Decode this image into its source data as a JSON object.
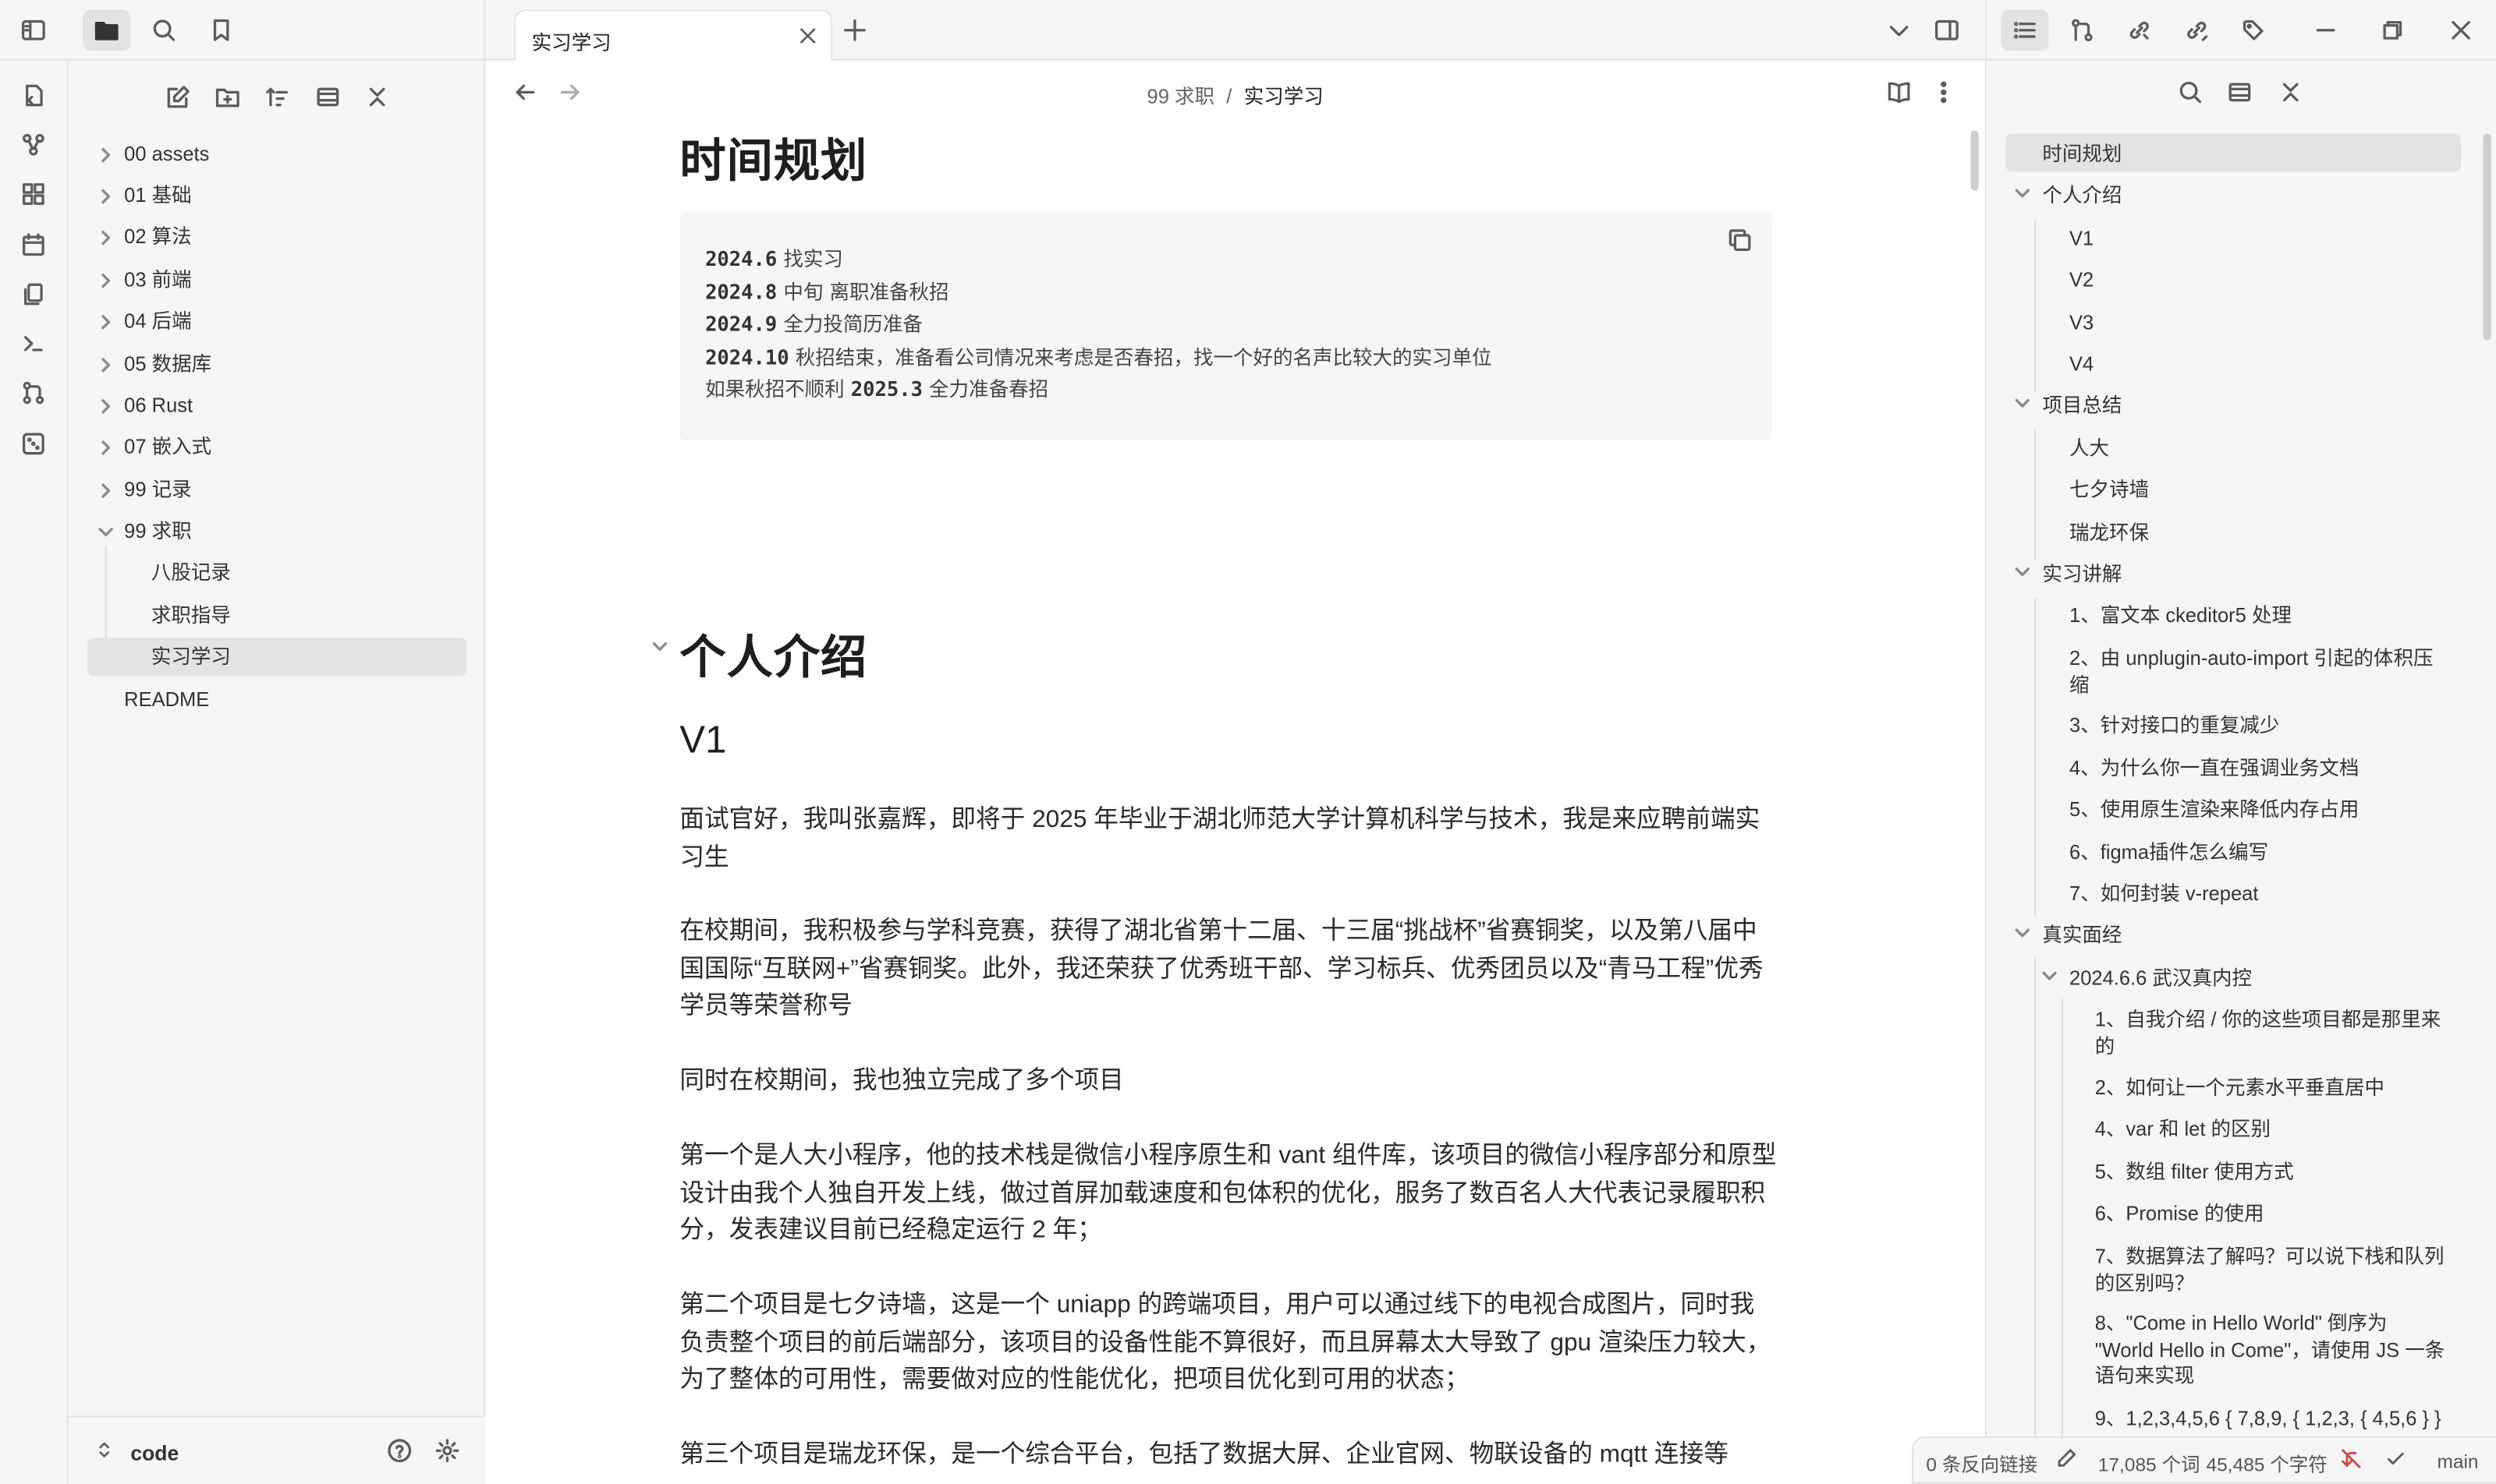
{
  "tab": {
    "title": "实习学习"
  },
  "breadcrumb": {
    "parent": "99 求职",
    "sep": "/",
    "current": "实习学习"
  },
  "explorer": {
    "items": [
      {
        "label": "00 assets"
      },
      {
        "label": "01 基础"
      },
      {
        "label": "02 算法"
      },
      {
        "label": "03 前端"
      },
      {
        "label": "04 后端"
      },
      {
        "label": "05 数据库"
      },
      {
        "label": "06 Rust"
      },
      {
        "label": "07 嵌入式"
      },
      {
        "label": "99 记录"
      },
      {
        "label": "99 求职"
      }
    ],
    "children": [
      {
        "label": "八股记录"
      },
      {
        "label": "求职指导"
      },
      {
        "label": "实习学习"
      }
    ],
    "readme": "README",
    "vault_name": "code"
  },
  "doc": {
    "h_time": "时间规划",
    "code_lines": [
      {
        "b": "2024.6",
        "t": " 找实习"
      },
      {
        "b": "2024.8",
        "t": " 中旬 离职准备秋招"
      },
      {
        "b": "2024.9",
        "t": " 全力投简历准备"
      },
      {
        "b": "2024.10",
        "t": " 秋招结束，准备看公司情况来考虑是否春招，找一个好的名声比较大的实习单位"
      },
      {
        "pre": "如果秋招不顺利 ",
        "b": "2025.3",
        "t": " 全力准备春招"
      }
    ],
    "h_intro": "个人介绍",
    "h_v1": "V1",
    "p1": "面试官好，我叫张嘉辉，即将于 2025 年毕业于湖北师范大学计算机科学与技术，我是来应聘前端实习生",
    "p2": "在校期间，我积极参与学科竞赛，获得了湖北省第十二届、十三届“挑战杯”省赛铜奖，以及第八届中国国际“互联网+”省赛铜奖。此外，我还荣获了优秀班干部、学习标兵、优秀团员以及“青马工程”优秀学员等荣誉称号",
    "p3": "同时在校期间，我也独立完成了多个项目",
    "p4": "第一个是人大小程序，他的技术栈是微信小程序原生和 vant 组件库，该项目的微信小程序部分和原型设计由我个人独自开发上线，做过首屏加载速度和包体积的优化，服务了数百名人大代表记录履职积分，发表建议目前已经稳定运行 2 年；",
    "p5": "第二个项目是七夕诗墙，这是一个 uniapp 的跨端项目，用户可以通过线下的电视合成图片，同时我负责整个项目的前后端部分，该项目的设备性能不算很好，而且屏幕太大导致了 gpu 渲染压力较大，为了整体的可用性，需要做对应的性能优化，把项目优化到可用的状态；",
    "p6": "第三个项目是瑞龙环保，是一个综合平台，包括了数据大屏、企业官网、物联设备的 mqtt 连接等"
  },
  "outline": {
    "items": [
      {
        "label": "时间规划"
      },
      {
        "label": "个人介绍"
      },
      {
        "label": "V1"
      },
      {
        "label": "V2"
      },
      {
        "label": "V3"
      },
      {
        "label": "V4"
      },
      {
        "label": "项目总结"
      },
      {
        "label": "人大"
      },
      {
        "label": "七夕诗墙"
      },
      {
        "label": "瑞龙环保"
      },
      {
        "label": "实习讲解"
      },
      {
        "label": "1、富文本 ckeditor5 处理"
      },
      {
        "label": "2、由 unplugin-auto-import 引起的体积压缩"
      },
      {
        "label": "3、针对接口的重复减少"
      },
      {
        "label": "4、为什么你一直在强调业务文档"
      },
      {
        "label": "5、使用原生渲染来降低内存占用"
      },
      {
        "label": "6、figma插件怎么编写"
      },
      {
        "label": "7、如何封装 v-repeat"
      },
      {
        "label": "真实面经"
      },
      {
        "label": "2024.6.6 武汉真内控"
      },
      {
        "label": "1、自我介绍 / 你的这些项目都是那里来的"
      },
      {
        "label": "2、如何让一个元素水平垂直居中"
      },
      {
        "label": "4、var 和 let 的区别"
      },
      {
        "label": "5、数组 filter 使用方式"
      },
      {
        "label": "6、Promise 的使用"
      },
      {
        "label": "7、数据算法了解吗？可以说下栈和队列的区别吗？"
      },
      {
        "label": "8、\"Come in Hello World\" 倒序为 \"World Hello in Come\"，请使用 JS 一条语句来实现"
      },
      {
        "label": "9、1,2,3,4,5,6 { 7,8,9, { 1,2,3, { 4,5,6 } }"
      }
    ]
  },
  "status": {
    "backlinks": "0 条反向链接",
    "words": "17,085 个词",
    "chars": "45,485 个字符",
    "branch": "main"
  }
}
